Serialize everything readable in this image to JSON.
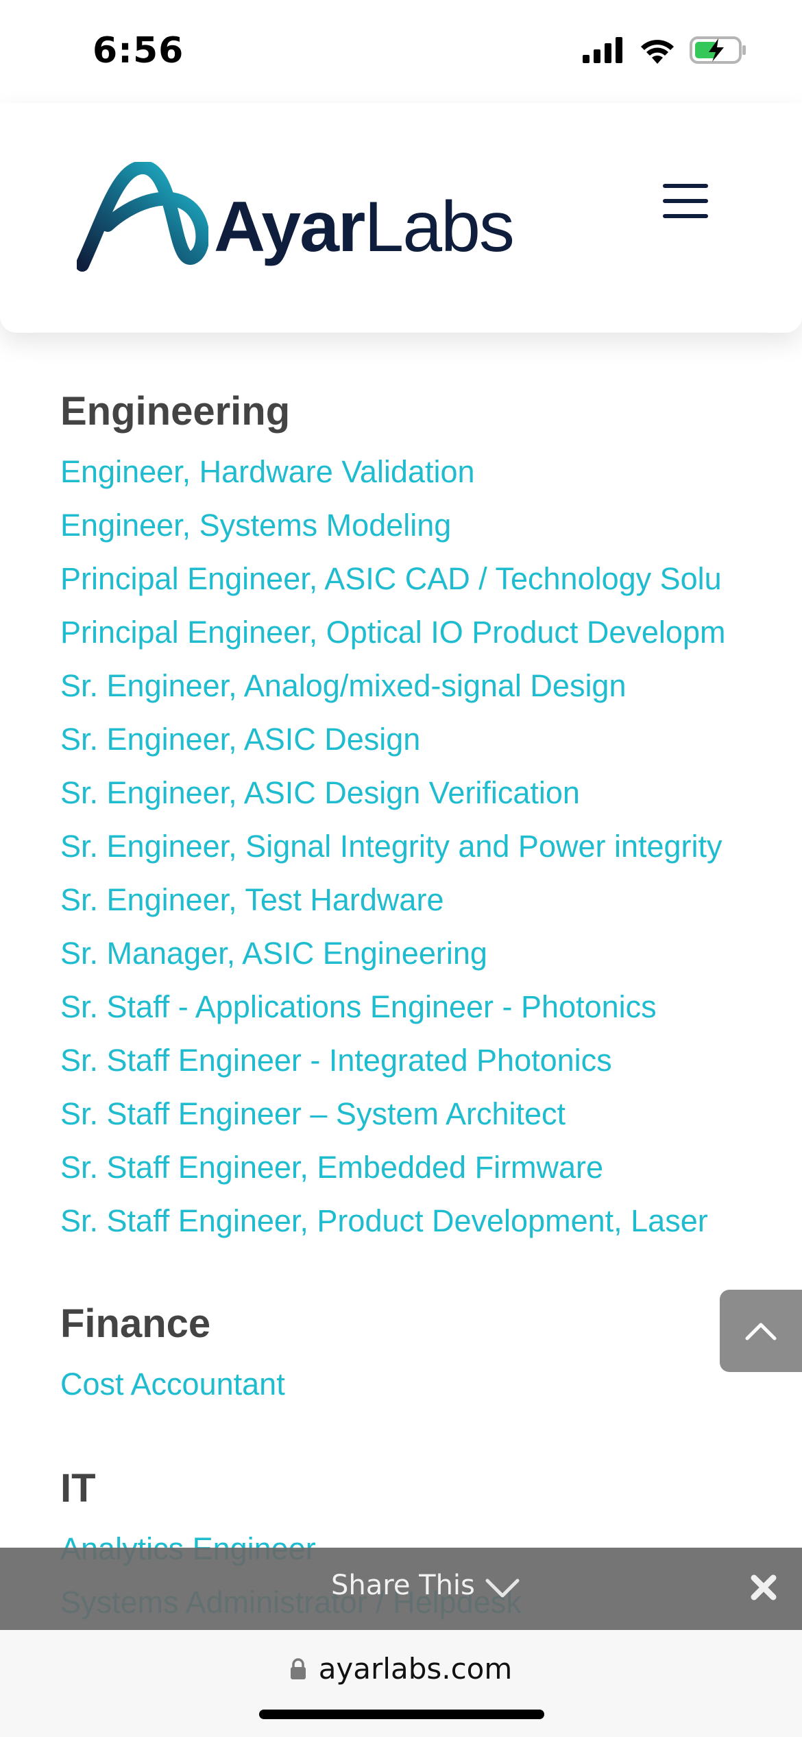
{
  "status_bar": {
    "time": "6:56",
    "icons": [
      "cellular-signal-icon",
      "wifi-icon",
      "battery-charging-icon"
    ]
  },
  "header": {
    "logo_part1": "Ayar",
    "logo_part2": "Labs",
    "brand_colors": {
      "navy": "#0f1e3d",
      "teal": "#1fb3c8"
    },
    "menu_icon": "hamburger-menu-icon"
  },
  "sections": {
    "engineering": {
      "title": "Engineering",
      "jobs": [
        "Engineer, Hardware Validation",
        "Engineer, Systems Modeling",
        "Principal Engineer, ASIC CAD / Technology Solu",
        "Principal Engineer, Optical IO Product Developm",
        "Sr. Engineer, Analog/mixed-signal Design",
        "Sr. Engineer, ASIC Design",
        "Sr. Engineer, ASIC Design Verification",
        "Sr. Engineer, Signal Integrity and Power integrity",
        "Sr. Engineer, Test Hardware",
        "Sr. Manager, ASIC Engineering",
        "Sr. Staff - Applications Engineer - Photonics",
        "Sr. Staff Engineer - Integrated Photonics",
        "Sr. Staff Engineer – System Architect",
        "Sr. Staff Engineer, Embedded Firmware",
        "Sr. Staff Engineer, Product Development, Laser"
      ]
    },
    "finance": {
      "title": "Finance",
      "jobs": [
        "Cost Accountant"
      ]
    },
    "it": {
      "title": "IT",
      "jobs": [
        "Analytics Engineer",
        "Systems Administrator / Helpdesk"
      ]
    }
  },
  "colors": {
    "link": "#1fbcd0",
    "heading": "#444444",
    "share_bar": "#696969",
    "back_to_top": "#8c8c8c"
  },
  "back_to_top": {
    "icon": "chevron-up-icon"
  },
  "share_bar": {
    "label": "Share This",
    "chevron_icon": "chevron-down-icon",
    "close_icon": "close-icon"
  },
  "browser": {
    "url": "ayarlabs.com",
    "lock_icon": "lock-icon"
  }
}
